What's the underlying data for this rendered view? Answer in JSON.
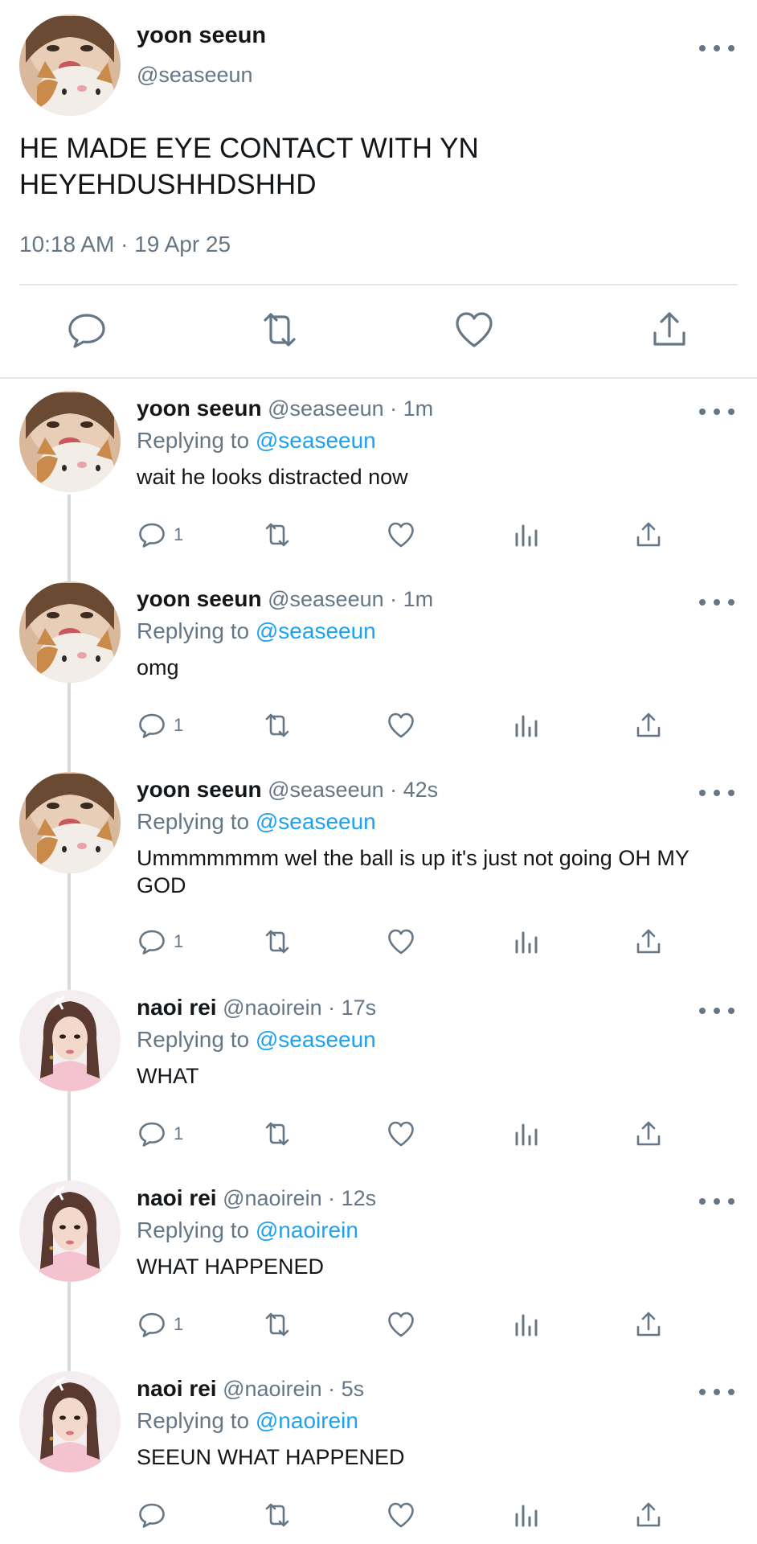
{
  "main_tweet": {
    "name": "yoon seeun",
    "handle": "@seaseeun",
    "text": "HE MADE EYE CONTACT WITH YN\nHEYEHDUSHHDSHHD",
    "timestamp": "10:18 AM · 19 Apr 25",
    "actions": [
      "reply-icon",
      "retweet-icon",
      "like-icon",
      "share-icon"
    ]
  },
  "replies": [
    {
      "name": "yoon seeun",
      "meta": "@seaseeun · 1m",
      "replying_prefix": "Replying to",
      "replying_to": "@seaseeun",
      "text": "wait he looks distracted now",
      "reply_count": "1",
      "avatar": "cat-selfie"
    },
    {
      "name": "yoon seeun",
      "meta": "@seaseeun · 1m",
      "replying_prefix": "Replying to",
      "replying_to": "@seaseeun",
      "text": "omg",
      "reply_count": "1",
      "avatar": "cat-selfie"
    },
    {
      "name": "yoon seeun",
      "meta": "@seaseeun · 42s",
      "replying_prefix": "Replying to",
      "replying_to": "@seaseeun",
      "text": "Ummmmmmm wel the ball is up it's just not going OH MY GOD",
      "reply_count": "1",
      "avatar": "cat-selfie"
    },
    {
      "name": "naoi rei",
      "meta": "@naoirein · 17s",
      "replying_prefix": "Replying to",
      "replying_to": "@seaseeun",
      "text": "WHAT",
      "reply_count": "1",
      "avatar": "pink-portrait"
    },
    {
      "name": "naoi rei",
      "meta": "@naoirein · 12s",
      "replying_prefix": "Replying to",
      "replying_to": "@naoirein",
      "text": "WHAT HAPPENED",
      "reply_count": "1",
      "avatar": "pink-portrait"
    },
    {
      "name": "naoi rei",
      "meta": "@naoirein · 5s",
      "replying_prefix": "Replying to",
      "replying_to": "@naoirein",
      "text": "SEEUN WHAT HAPPENED",
      "reply_count": "",
      "avatar": "pink-portrait"
    }
  ],
  "colors": {
    "text": "#14171a",
    "secondary": "#657786",
    "link": "#1da1f2",
    "divider": "#e1e8ed",
    "thread_line": "#d6dbdf"
  }
}
